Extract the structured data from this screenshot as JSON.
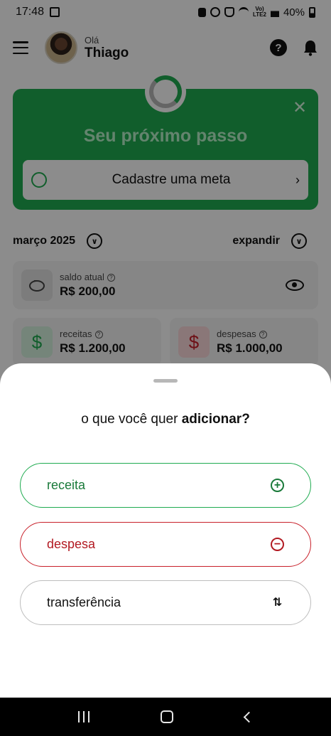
{
  "status_bar": {
    "time": "17:48",
    "battery": "40%",
    "network": "LTE2"
  },
  "header": {
    "greeting": "Olá",
    "user_name": "Thiago"
  },
  "next_step": {
    "title": "Seu próximo passo",
    "action_label": "Cadastre uma meta"
  },
  "period": {
    "month": "março 2025",
    "expand_label": "expandir"
  },
  "cards": {
    "balance": {
      "label": "saldo atual",
      "value": "R$ 200,00"
    },
    "income": {
      "label": "receitas",
      "value": "R$ 1.200,00"
    },
    "expense": {
      "label": "despesas",
      "value": "R$ 1.000,00"
    }
  },
  "sheet": {
    "title_prefix": "o que você quer ",
    "title_bold": "adicionar?",
    "options": [
      {
        "label": "receita",
        "icon": "plus-circle-icon",
        "color": "#1fab50"
      },
      {
        "label": "despesa",
        "icon": "minus-circle-icon",
        "color": "#c8202a"
      },
      {
        "label": "transferência",
        "icon": "swap-vertical-icon",
        "color": "#bdbdbd"
      }
    ]
  },
  "colors": {
    "brand_green": "#1fab50",
    "expense_red": "#c8202a"
  }
}
